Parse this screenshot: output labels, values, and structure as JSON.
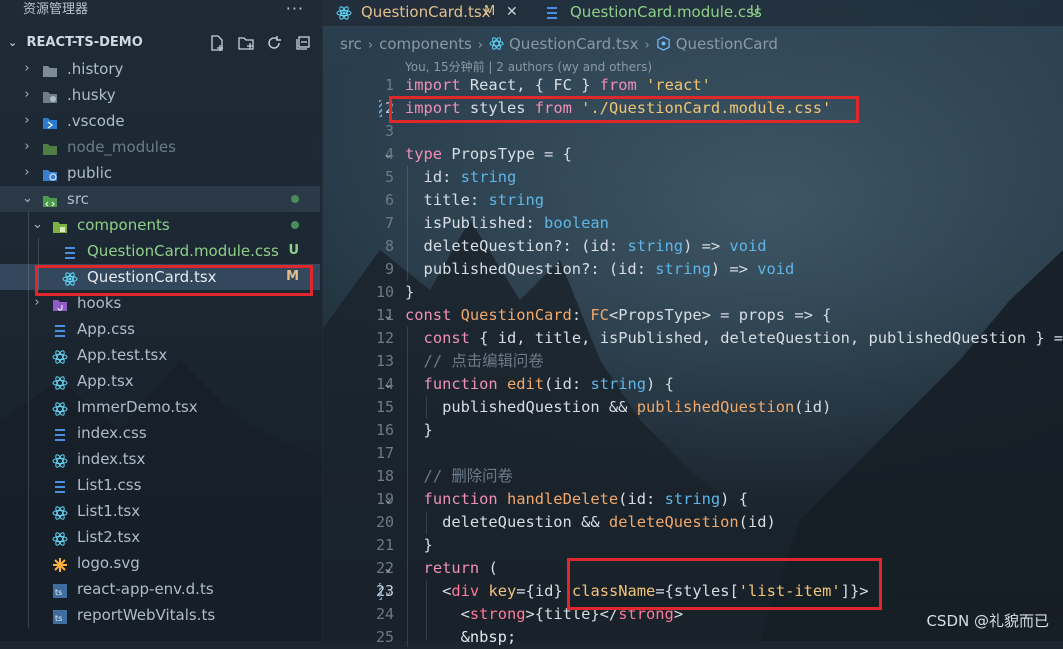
{
  "explorer": {
    "title": "资源管理器",
    "more": "···",
    "project": "REACT-TS-DEMO",
    "items": [
      {
        "label": ".history",
        "badge": ""
      },
      {
        "label": ".husky",
        "badge": ""
      },
      {
        "label": ".vscode",
        "badge": ""
      },
      {
        "label": "node_modules",
        "badge": ""
      },
      {
        "label": "public",
        "badge": ""
      },
      {
        "label": "src",
        "badge": ""
      },
      {
        "label": "components",
        "badge": ""
      },
      {
        "label": "QuestionCard.module.css",
        "badge": "U"
      },
      {
        "label": "QuestionCard.tsx",
        "badge": "M"
      },
      {
        "label": "hooks",
        "badge": ""
      },
      {
        "label": "App.css",
        "badge": ""
      },
      {
        "label": "App.test.tsx",
        "badge": ""
      },
      {
        "label": "App.tsx",
        "badge": ""
      },
      {
        "label": "ImmerDemo.tsx",
        "badge": ""
      },
      {
        "label": "index.css",
        "badge": ""
      },
      {
        "label": "index.tsx",
        "badge": ""
      },
      {
        "label": "List1.css",
        "badge": ""
      },
      {
        "label": "List1.tsx",
        "badge": ""
      },
      {
        "label": "List2.tsx",
        "badge": ""
      },
      {
        "label": "logo.svg",
        "badge": ""
      },
      {
        "label": "react-app-env.d.ts",
        "badge": ""
      },
      {
        "label": "reportWebVitals.ts",
        "badge": ""
      }
    ]
  },
  "tabs": [
    {
      "label": "QuestionCard.tsx",
      "status": "M",
      "close": "✕"
    },
    {
      "label": "QuestionCard.module.css",
      "status": "U"
    }
  ],
  "breadcrumb": {
    "parts": [
      "src",
      "components",
      "QuestionCard.tsx",
      "QuestionCard"
    ]
  },
  "blame": "You, 15分钟前 | 2 authors (wy and others)",
  "code": {
    "line_numbers": [
      "1",
      "2",
      "3",
      "4",
      "5",
      "6",
      "7",
      "8",
      "9",
      "10",
      "11",
      "12",
      "13",
      "14",
      "15",
      "16",
      "17",
      "18",
      "19",
      "20",
      "21",
      "22",
      "23",
      "24",
      "25"
    ]
  },
  "colors": {
    "highlight_box": "#e0282c",
    "keyword": "#f08fb7",
    "string": "#f0c674",
    "type": "#5fb5e6",
    "function": "#f2a86a"
  },
  "watermark": "CSDN @礼貌而已"
}
